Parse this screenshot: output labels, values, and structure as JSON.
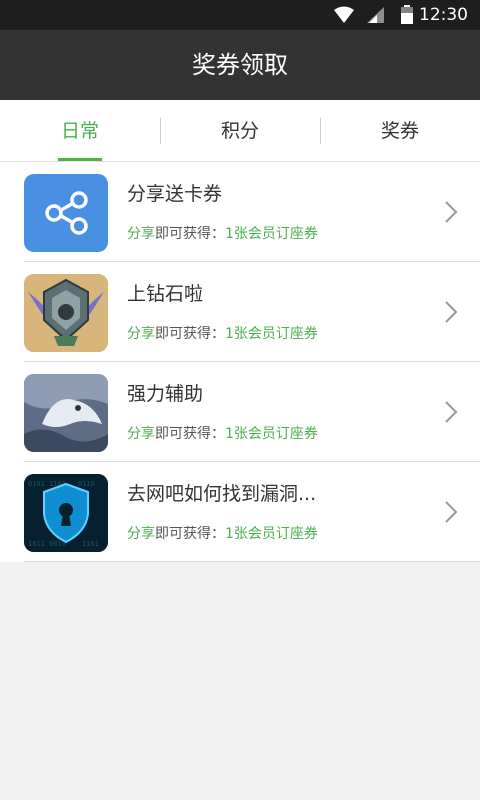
{
  "status_bar": {
    "time": "12:30"
  },
  "header": {
    "title": "奖券领取"
  },
  "tabs": [
    {
      "label": "日常",
      "active": true
    },
    {
      "label": "积分",
      "active": false
    },
    {
      "label": "奖券",
      "active": false
    }
  ],
  "items": [
    {
      "title": "分享送卡券",
      "sub_action": "分享",
      "sub_middle": "即可获得：",
      "sub_reward": "1张会员订座券",
      "icon": "share-icon"
    },
    {
      "title": "上钻石啦",
      "sub_action": "分享",
      "sub_middle": "即可获得：",
      "sub_reward": "1张会员订座券",
      "icon": "diamond-badge-image"
    },
    {
      "title": "强力辅助",
      "sub_action": "分享",
      "sub_middle": "即可获得：",
      "sub_reward": "1张会员订座券",
      "icon": "dragon-artwork-image"
    },
    {
      "title": "去网吧如何找到漏洞...",
      "sub_action": "分享",
      "sub_middle": "即可获得：",
      "sub_reward": "1张会员订座券",
      "icon": "security-shield-image"
    }
  ],
  "colors": {
    "accent": "#4caf50",
    "title_bar": "#333333",
    "status_bar": "#1e1e1e",
    "share_blue": "#4a90e2"
  }
}
